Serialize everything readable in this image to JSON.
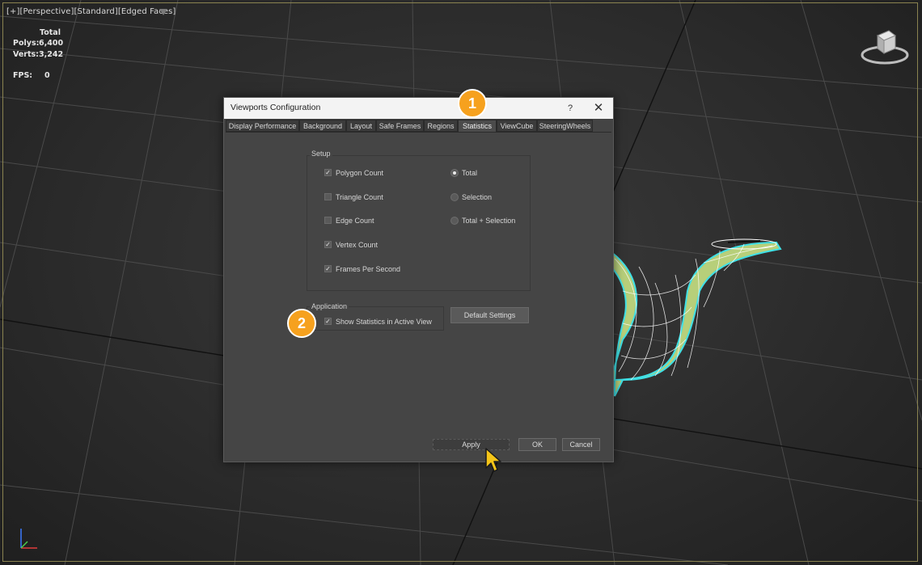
{
  "viewport": {
    "labels": [
      "[+]",
      "[Perspective]",
      "[Standard]",
      "[Edged Faces]"
    ],
    "stats": {
      "header": "Total",
      "polys_label": "Polys:",
      "polys_value": "6,400",
      "verts_label": "Verts:",
      "verts_value": "3,242",
      "fps_label": "FPS:",
      "fps_value": "0"
    }
  },
  "dialog": {
    "title": "Viewports Configuration",
    "help": "?",
    "close": "✕",
    "tabs": [
      "Display Performance",
      "Background",
      "Layout",
      "Safe Frames",
      "Regions",
      "Statistics",
      "ViewCube",
      "SteeringWheels"
    ],
    "active_tab": "Statistics",
    "setup": {
      "label": "Setup",
      "checkboxes": [
        {
          "label": "Polygon Count",
          "checked": true
        },
        {
          "label": "Triangle Count",
          "checked": false
        },
        {
          "label": "Edge Count",
          "checked": false
        },
        {
          "label": "Vertex Count",
          "checked": true
        },
        {
          "label": "Frames Per Second",
          "checked": true
        }
      ],
      "radios": [
        {
          "label": "Total",
          "selected": true
        },
        {
          "label": "Selection",
          "selected": false
        },
        {
          "label": "Total + Selection",
          "selected": false
        }
      ]
    },
    "application": {
      "label": "Application",
      "show_stats": {
        "label": "Show Statistics in Active View",
        "checked": true
      },
      "default_button": "Default Settings"
    },
    "buttons": {
      "apply": "Apply",
      "ok": "OK",
      "cancel": "Cancel"
    }
  },
  "callouts": {
    "one": "1",
    "two": "2"
  },
  "colors": {
    "accent": "#f6a11e",
    "mesh": "#b7cf7a",
    "selection": "#3fe0e6"
  }
}
